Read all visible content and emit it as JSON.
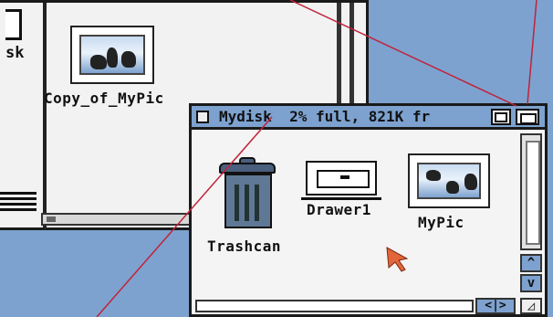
{
  "desktop": {
    "disk_icon_fragment_label": "sk",
    "copy_icon": {
      "label": "Copy_of_MyPic",
      "icon": "picture-icon"
    }
  },
  "window": {
    "title": "Mydisk",
    "status": "2% full, 821K fr",
    "icons": [
      {
        "label": "Trashcan",
        "icon": "trashcan-icon"
      },
      {
        "label": "Drawer1",
        "icon": "drawer-icon"
      },
      {
        "label": "MyPic",
        "icon": "picture-icon"
      }
    ],
    "scroll_up_glyph": "^",
    "scroll_down_glyph": "v",
    "scroll_leftright_glyph": "<|>",
    "sizing_glyph": "◿"
  },
  "colors": {
    "workbench_blue": "#7da2cf",
    "window_bg": "#f4f4f4",
    "cursor_orange": "#e2663a",
    "annotation_line": "#c2223a"
  }
}
